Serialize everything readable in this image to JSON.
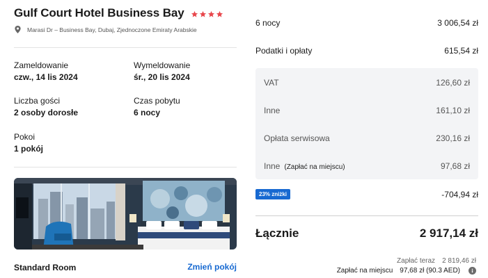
{
  "hotel": {
    "name": "Gulf Court Hotel Business Bay",
    "stars": 4,
    "address": "Marasi Dr – Business Bay, Dubaj, Zjednoczone Emiraty Arabskie"
  },
  "booking": {
    "checkin_label": "Zameldowanie",
    "checkin_value": "czw., 14 lis 2024",
    "checkout_label": "Wymeldowanie",
    "checkout_value": "śr., 20 lis 2024",
    "guests_label": "Liczba gości",
    "guests_value": "2 osoby dorosłe",
    "stay_label": "Czas pobytu",
    "stay_value": "6 nocy",
    "rooms_label": "Pokoi",
    "rooms_value": "1 pokój"
  },
  "room": {
    "name": "Standard Room",
    "change_label": "Zmień pokój"
  },
  "price": {
    "nights_label": "6 nocy",
    "nights_value": "3 006,54 zł",
    "taxes_label": "Podatki i opłaty",
    "taxes_value": "615,54 zł",
    "tax_items": [
      {
        "label": "VAT",
        "note": "",
        "value": "126,60 zł"
      },
      {
        "label": "Inne",
        "note": "",
        "value": "161,10 zł"
      },
      {
        "label": "Opłata serwisowa",
        "note": "",
        "value": "230,16 zł"
      },
      {
        "label": "Inne",
        "note": "(Zapłać na miejscu)",
        "value": "97,68 zł"
      }
    ],
    "discount_badge": "23% zniżki",
    "discount_value": "-704,94 zł",
    "total_label": "Łącznie",
    "total_value": "2 917,14 zł",
    "pay_now_label": "Zapłać teraz",
    "pay_now_value": "2 819,46 zł",
    "pay_hotel_label": "Zapłać na miejscu",
    "pay_hotel_value": "97,68 zł (90.3 AED)"
  },
  "colors": {
    "accent": "#1769d1",
    "star": "#e8474c",
    "tax_bg": "#f3f4f6"
  }
}
